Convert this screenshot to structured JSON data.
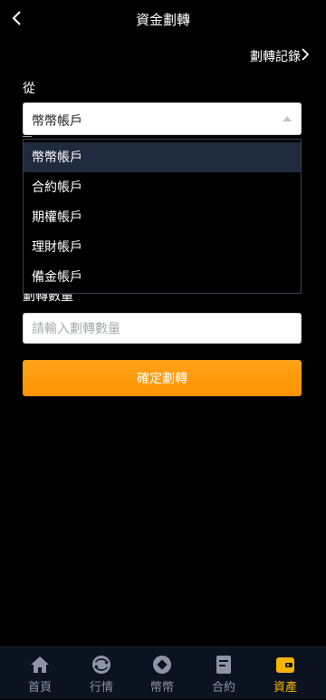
{
  "header": {
    "title": "資金劃轉",
    "history_link": "劃轉記錄"
  },
  "form": {
    "from_label": "從",
    "selected_account": "幣幣帳戶",
    "amount_label": "劃轉數量",
    "amount_placeholder": "請輸入劃轉數量",
    "confirm_label": "確定劃轉"
  },
  "dropdown": {
    "options": [
      "幣幣帳戶",
      "合約帳戶",
      "期權帳戶",
      "理財帳戶",
      "備金帳戶"
    ],
    "selected_index": 0
  },
  "tabbar": {
    "items": [
      {
        "label": "首頁",
        "icon": "home-icon"
      },
      {
        "label": "行情",
        "icon": "market-icon"
      },
      {
        "label": "幣幣",
        "icon": "coin-icon"
      },
      {
        "label": "合約",
        "icon": "contract-icon"
      },
      {
        "label": "資產",
        "icon": "wallet-icon"
      }
    ],
    "active_index": 4
  },
  "colors": {
    "accent": "#ff9b0f",
    "active_tab": "#f5b400",
    "inactive_tab": "#8d95a5",
    "tabbar_bg": "#0b1220"
  }
}
